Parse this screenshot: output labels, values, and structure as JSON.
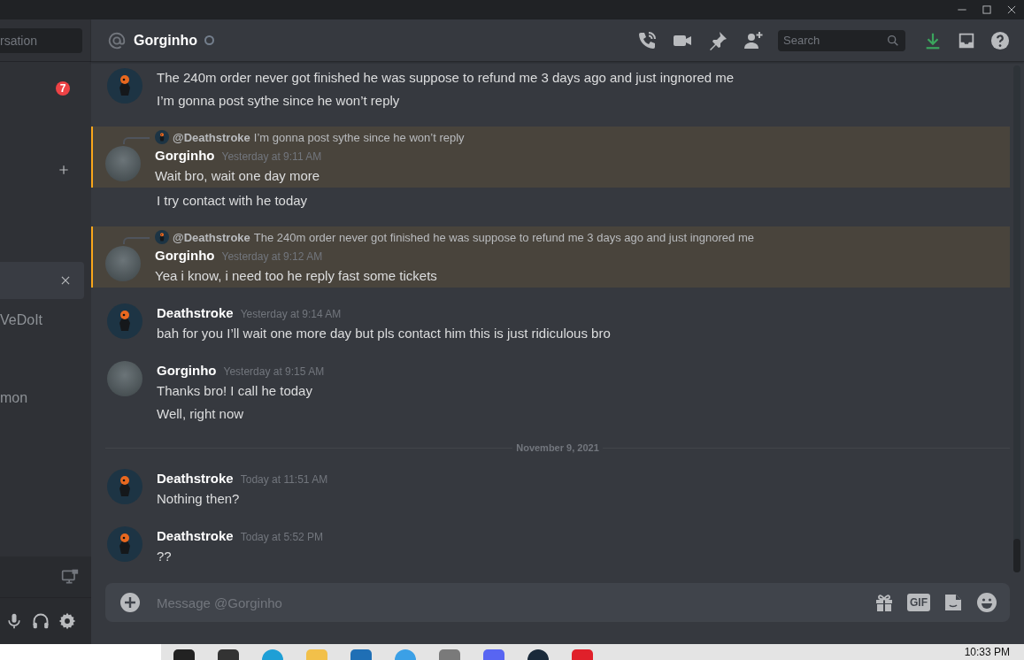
{
  "sidebar": {
    "search_placeholder": "rsation",
    "items": [
      {
        "kind": "badge",
        "badge": "7"
      },
      {
        "kind": "add"
      },
      {
        "kind": "dm",
        "selected": true
      },
      {
        "kind": "dm",
        "label": "VeDoIt",
        "selected": false
      },
      {
        "kind": "dm",
        "label": "mon",
        "selected": false
      }
    ]
  },
  "header": {
    "channel": "Gorginho",
    "search_placeholder": "Search"
  },
  "messages": [
    {
      "kind": "cut",
      "avatar": {
        "kind": "drawing"
      },
      "highlighted": false,
      "lines": [
        "The 240m order never got finished he was suppose to refund me 3 days ago and just ingnored me",
        "I’m gonna post sythe since he won’t reply"
      ]
    },
    {
      "kind": "message",
      "avatar": {
        "kind": "photo"
      },
      "author": "Gorginho",
      "timestamp": "Yesterday at 9:11 AM",
      "highlighted": true,
      "reply": {
        "author": "@Deathstroke",
        "text": "I’m gonna post sythe since he won’t reply"
      },
      "lines": [
        "Wait bro, wait one day more"
      ]
    },
    {
      "kind": "continuation",
      "highlighted": false,
      "lines": [
        "I try contact with he today"
      ]
    },
    {
      "kind": "message",
      "avatar": {
        "kind": "photo"
      },
      "author": "Gorginho",
      "timestamp": "Yesterday at 9:12 AM",
      "highlighted": true,
      "reply": {
        "author": "@Deathstroke",
        "text": "The 240m order never got finished he was suppose to refund me 3 days ago and just ingnored me"
      },
      "lines": [
        "Yea i know, i need too he reply fast some tickets"
      ]
    },
    {
      "kind": "message",
      "avatar": {
        "kind": "drawing"
      },
      "author": "Deathstroke",
      "timestamp": "Yesterday at 9:14 AM",
      "highlighted": false,
      "lines": [
        "bah for you I’ll wait one more day but pls contact him this is just ridiculous bro"
      ]
    },
    {
      "kind": "message",
      "avatar": {
        "kind": "photo"
      },
      "author": "Gorginho",
      "timestamp": "Yesterday at 9:15 AM",
      "highlighted": false,
      "lines": [
        "Thanks bro! I call he today",
        "Well, right now"
      ]
    },
    {
      "kind": "divider",
      "label": "November 9, 2021"
    },
    {
      "kind": "message",
      "avatar": {
        "kind": "drawing"
      },
      "author": "Deathstroke",
      "timestamp": "Today at 11:51 AM",
      "highlighted": false,
      "lines": [
        "Nothing then?"
      ]
    },
    {
      "kind": "message",
      "avatar": {
        "kind": "drawing"
      },
      "author": "Deathstroke",
      "timestamp": "Today at 5:52 PM",
      "highlighted": false,
      "lines": [
        "??"
      ]
    }
  ],
  "composer": {
    "placeholder": "Message @Gorginho",
    "gif_label": "GIF"
  },
  "taskbar": {
    "clock": "10:33 PM"
  }
}
